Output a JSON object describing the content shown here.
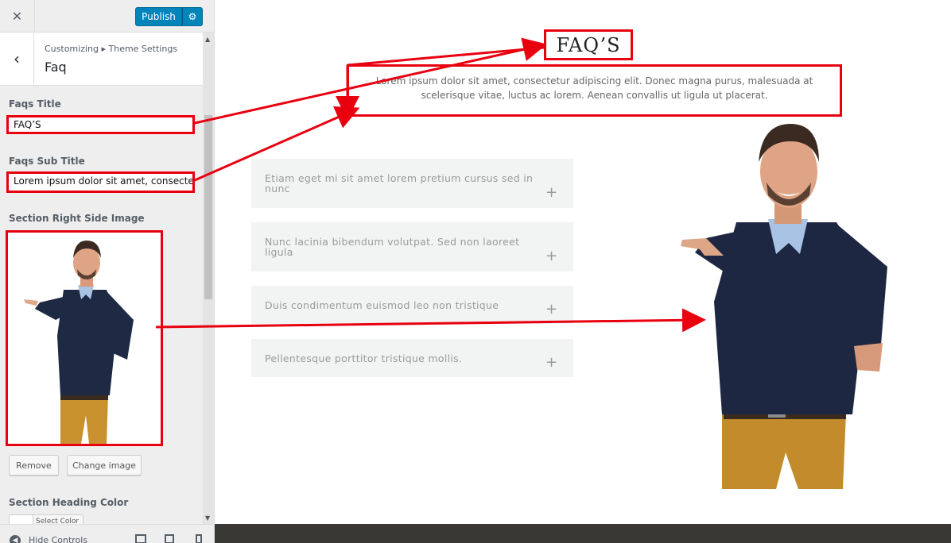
{
  "header": {
    "publish_label": "Publish",
    "close_icon": "close-icon",
    "gear_icon": "gear-icon"
  },
  "section": {
    "breadcrumb": "Customizing ▸ Theme Settings",
    "title": "Faq"
  },
  "fields": {
    "faqs_title_label": "Faqs Title",
    "faqs_title_value": "FAQ’S",
    "faqs_subtitle_label": "Faqs Sub Title",
    "faqs_subtitle_value": "Lorem ipsum dolor sit amet, consectetur",
    "image_label": "Section Right Side Image",
    "remove_label": "Remove",
    "change_image_label": "Change image",
    "heading_color_label": "Section Heading Color",
    "select_color_label": "Select Color"
  },
  "footer": {
    "hide_controls_label": "Hide Controls"
  },
  "preview": {
    "heading": "FAQ’S",
    "subheading": "Lorem ipsum dolor sit amet, consectetur adipiscing elit. Donec magna purus, malesuada at scelerisque vitae, luctus ac lorem. Aenean convallis ut ligula ut placerat.",
    "faq_items": [
      {
        "question": "Etiam eget mi sit amet lorem pretium cursus sed in nunc",
        "icon": "+"
      },
      {
        "question": "Nunc lacinia bibendum volutpat. Sed non laoreet ligula",
        "icon": "+"
      },
      {
        "question": "Duis condimentum euismod leo non tristique",
        "icon": "+"
      },
      {
        "question": "Pellentesque porttitor tristique mollis.",
        "icon": "+"
      }
    ]
  },
  "colors": {
    "accent": "#0085ba",
    "highlight": "#e8000f",
    "sidebar_bg": "#eeeeee",
    "accordion_bg": "#f2f3f3"
  }
}
